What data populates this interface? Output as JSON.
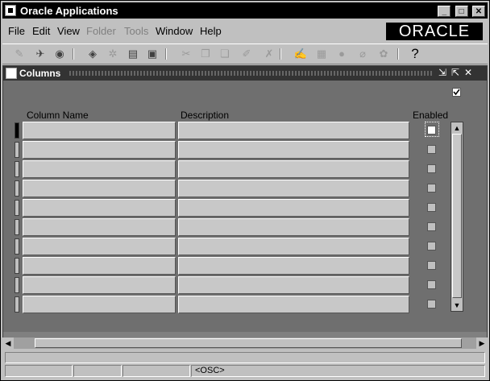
{
  "window": {
    "title": "Oracle Applications",
    "controls": [
      "_",
      "□",
      "✕"
    ]
  },
  "menu": {
    "file": "File",
    "edit": "Edit",
    "view": "View",
    "folder": "Folder",
    "tools": "Tools",
    "window": "Window",
    "help": "Help"
  },
  "brand": {
    "logo_text": "ORACLE"
  },
  "toolbar": {
    "icons": [
      "new-icon",
      "find-icon",
      "navigator-icon",
      "save-icon",
      "next-step-icon",
      "print-icon",
      "close-form-icon",
      "cut-icon",
      "copy-icon",
      "paste-icon",
      "clear-record-icon",
      "delete-record-icon",
      "edit-field-icon",
      "zoom-icon",
      "translations-icon",
      "attachments-icon",
      "folder-tools-icon",
      "help-icon"
    ],
    "help_glyph": "?"
  },
  "form": {
    "title": "Columns",
    "controls": {
      "minimize": "⇲",
      "maximize": "⇱",
      "close": "✕"
    },
    "headers": {
      "column_name": "Column Name",
      "description": "Description",
      "enabled": "Enabled"
    },
    "rows": [
      {
        "column_name": "",
        "description": "",
        "enabled": false
      },
      {
        "column_name": "",
        "description": "",
        "enabled": false
      },
      {
        "column_name": "",
        "description": "",
        "enabled": false
      },
      {
        "column_name": "",
        "description": "",
        "enabled": false
      },
      {
        "column_name": "",
        "description": "",
        "enabled": false
      },
      {
        "column_name": "",
        "description": "",
        "enabled": false
      },
      {
        "column_name": "",
        "description": "",
        "enabled": false
      },
      {
        "column_name": "",
        "description": "",
        "enabled": false
      },
      {
        "column_name": "",
        "description": "",
        "enabled": false
      },
      {
        "column_name": "",
        "description": "",
        "enabled": false
      }
    ]
  },
  "status": {
    "message": "",
    "osc": "<OSC>"
  }
}
